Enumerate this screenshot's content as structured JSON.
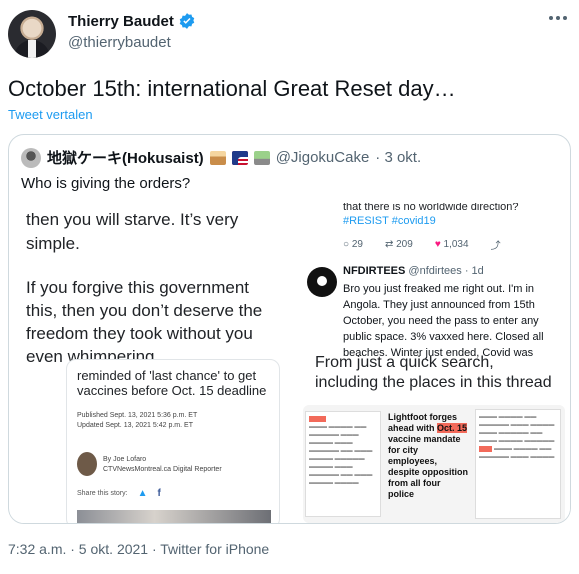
{
  "author": {
    "name": "Thierry Baudet",
    "handle": "@thierrybaudet"
  },
  "tweet": {
    "text": "October 15th: international Great Reset day…",
    "translate_label": "Tweet vertalen",
    "timestamp": "7:32 a.m. · 5 okt. 2021 · Twitter for iPhone"
  },
  "quoted": {
    "name": "地獄ケーキ(Hokusaist)",
    "handle": "@JigokuCake",
    "date": "· 3 okt.",
    "text": "Who is giving the orders?",
    "left_image": {
      "lines": [
        "then you will starve. It’s very",
        "simple.",
        "If you forgive this government",
        "this,  then you don’t deserve the",
        "freedom they took without you",
        "even whimpering."
      ],
      "article_title": [
        "reminded of 'last chance' to get",
        "vaccines before Oct. 15 deadline"
      ],
      "published": "Published Sept. 13, 2021 5:36 p.m. ET",
      "updated": "Updated Sept. 13, 2021 5:42 p.m. ET",
      "by_line": "By Joe Lofaro",
      "author_role": "CTVNewsMontreal.ca Digital Reporter",
      "share_label": "Share this story:"
    },
    "right_image": {
      "prev_tail": "that there is no worldwide direction?",
      "hashtags": "#RESIST #covid19",
      "stats": {
        "replies": "29",
        "retweets": "209",
        "likes": "1,034"
      },
      "reply_name": "NFDIRTEES",
      "reply_handle": "@nfdirtees · 1d",
      "reply_text": "Bro you just freaked me right out. I'm in Angola. They just announced from 15th October, you need the pass to enter any public space. 3% vaxxed here. Closed all beaches. Winter just ended, Covid was",
      "caption": [
        "From just a quick search,",
        "including the places in this thread"
      ],
      "headline": [
        "Lightfoot forges",
        "ahead with",
        "Oct. 15",
        "vaccine mandate",
        "for city employees,",
        "despite opposition",
        "from all four police"
      ]
    }
  },
  "colors": {
    "accent": "#1d9bf0",
    "muted": "#536471",
    "like": "#f91880",
    "border": "#cfd9de"
  }
}
